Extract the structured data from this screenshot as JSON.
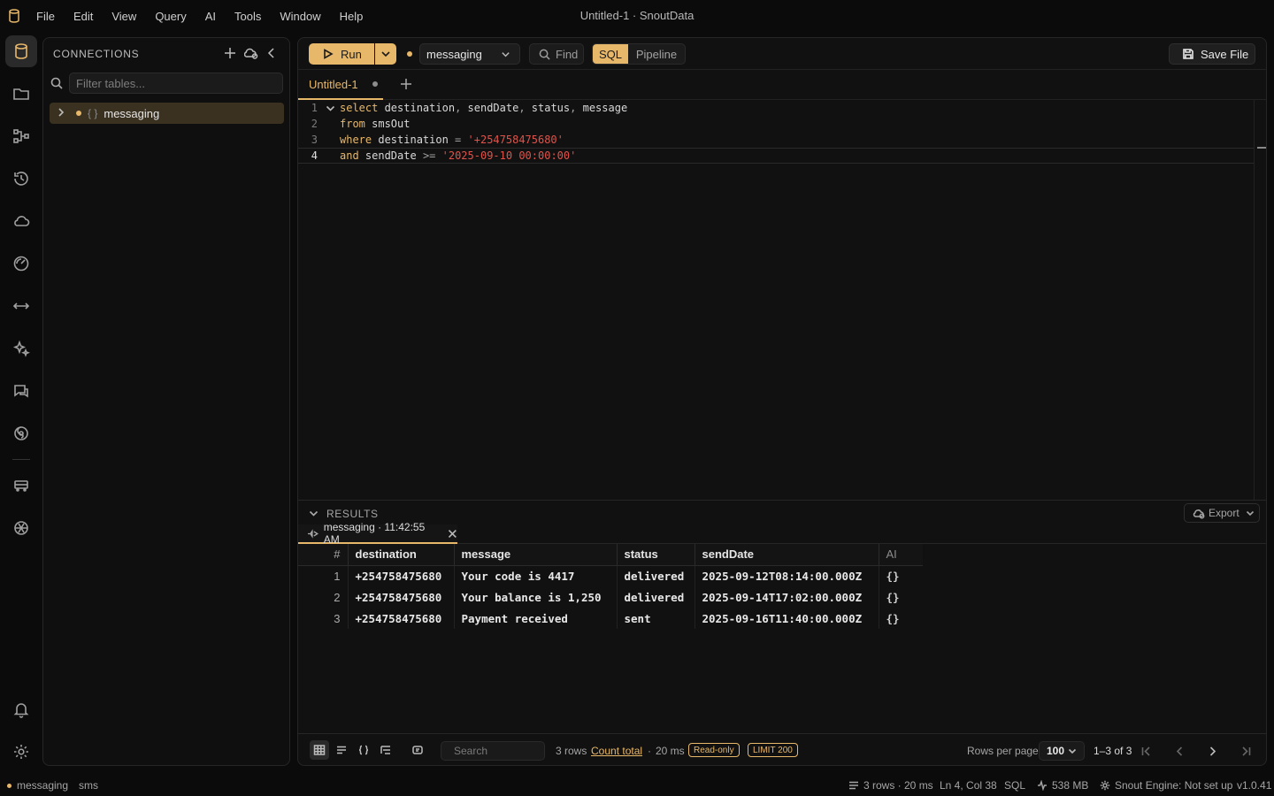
{
  "app": {
    "window_title": "Untitled-1 · SnoutData",
    "menu": [
      "File",
      "Edit",
      "View",
      "Query",
      "AI",
      "Tools",
      "Window",
      "Help"
    ]
  },
  "activity_bar": {
    "items": [
      "database-icon",
      "folder-icon",
      "pipeline-icon",
      "history-icon",
      "cloud-icon",
      "gauge-icon",
      "compare-icon",
      "sparkles-icon",
      "chat-icon",
      "spiral-icon",
      "bus-icon",
      "openai-icon",
      "bell-icon",
      "settings-icon"
    ]
  },
  "connections": {
    "title": "CONNECTIONS",
    "filter_placeholder": "Filter tables...",
    "items": [
      {
        "label": "messaging",
        "braces": "{ }"
      }
    ]
  },
  "toolbar": {
    "run_label": "Run",
    "db_selected": "messaging",
    "find_label": "Find",
    "mode_sql": "SQL",
    "mode_pipeline": "Pipeline",
    "save_label": "Save File"
  },
  "tabs": [
    {
      "label": "Untitled-1",
      "modified": true
    }
  ],
  "editor": {
    "current_line": 4,
    "lines": [
      {
        "n": "1",
        "tokens": [
          [
            "kw",
            "select"
          ],
          [
            "id",
            " destination"
          ],
          [
            "op",
            ","
          ],
          [
            "id",
            " sendDate"
          ],
          [
            "op",
            ","
          ],
          [
            "id",
            " status"
          ],
          [
            "op",
            ","
          ],
          [
            "id",
            " message"
          ]
        ]
      },
      {
        "n": "2",
        "tokens": [
          [
            "kw",
            "from"
          ],
          [
            "id",
            " smsOut"
          ]
        ]
      },
      {
        "n": "3",
        "tokens": [
          [
            "kw",
            "where"
          ],
          [
            "id",
            " destination "
          ],
          [
            "op",
            "="
          ],
          [
            "id",
            " "
          ],
          [
            "str",
            "'+254758475680'"
          ]
        ]
      },
      {
        "n": "4",
        "tokens": [
          [
            "kw",
            "and"
          ],
          [
            "id",
            " sendDate "
          ],
          [
            "op",
            ">="
          ],
          [
            "id",
            " "
          ],
          [
            "str",
            "'2025-09-10 00:00:00'"
          ]
        ]
      }
    ]
  },
  "results": {
    "title": "RESULTS",
    "export_label": "Export",
    "tab_label": "messaging · 11:42:55 AM",
    "columns": [
      "#",
      "destination",
      "message",
      "status",
      "sendDate",
      "AI"
    ],
    "rows": [
      [
        "1",
        "+254758475680",
        "Your code is 4417",
        "delivered",
        "2025-09-12T08:14:00.000Z",
        "{}"
      ],
      [
        "2",
        "+254758475680",
        "Your balance is 1,250",
        "delivered",
        "2025-09-14T17:02:00.000Z",
        "{}"
      ],
      [
        "3",
        "+254758475680",
        "Payment received",
        "sent",
        "2025-09-16T11:40:00.000Z",
        "{}"
      ]
    ],
    "footer": {
      "search_placeholder": "Search",
      "row_count": "3 rows",
      "count_total": "Count total",
      "separator": "·",
      "duration": "20 ms",
      "readonly_badge": "Read-only",
      "limit_badge": "LIMIT 200",
      "rows_per_page_label": "Rows per page",
      "rows_per_page": "100",
      "range": "1–3 of 3"
    }
  },
  "statusbar": {
    "connection": "messaging",
    "database": "sms",
    "result_summary": "3 rows · 20 ms",
    "cursor": "Ln 4, Col 38",
    "language": "SQL",
    "memory": "538 MB",
    "engine": "Snout Engine: Not set up",
    "version": "v1.0.41"
  },
  "colors": {
    "accent": "#e8b86a",
    "string": "#e0534a",
    "background": "#0b0b0b"
  }
}
